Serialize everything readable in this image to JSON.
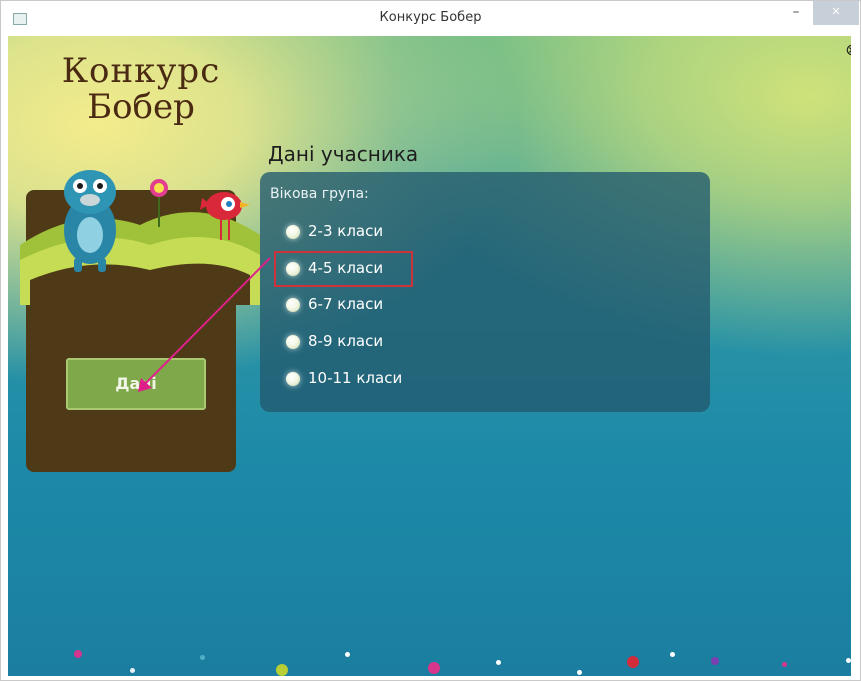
{
  "window": {
    "title": "Конкурс Бобер",
    "minimize_symbol": "–",
    "maximize_symbol": "☐",
    "close_symbol": "✕"
  },
  "app": {
    "close_symbol": "⊗",
    "logo_line1": "Конкурс",
    "logo_line2": "Бобер",
    "data_button_label": "Дані"
  },
  "participant": {
    "section_title": "Дані учасника",
    "age_group_label": "Вікова група:",
    "options": [
      {
        "label": "2-3 класи"
      },
      {
        "label": "4-5 класи"
      },
      {
        "label": "6-7 класи"
      },
      {
        "label": "8-9 класи"
      },
      {
        "label": "10-11 класи"
      }
    ],
    "highlighted_option": "4-5 класи"
  },
  "colors": {
    "highlight_border": "#d0323c",
    "arrow": "#e0208a",
    "button_fill": "#7fa84a",
    "hill_brown": "#4e3a17"
  }
}
